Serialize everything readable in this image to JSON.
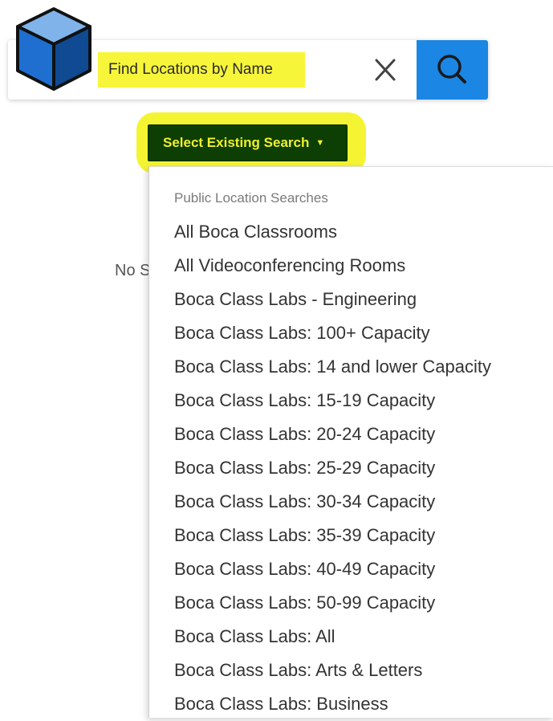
{
  "logo": {
    "icon": "cube-icon",
    "colors": {
      "top": "#7fb3ea",
      "left": "#1f6fd0",
      "right": "#0f4a93",
      "outline": "#111111"
    }
  },
  "search": {
    "placeholder": "Find Locations by Name",
    "value": "",
    "clear_icon": "close-icon",
    "submit_icon": "search-icon",
    "accent_color": "#1b86e3",
    "highlight_color": "#f7f53a"
  },
  "saved_search": {
    "button_label": "Select Existing Search",
    "caret_icon": "caret-down-icon",
    "button_color": "#0d3f04"
  },
  "background_text": "No S",
  "dropdown": {
    "header": "Public Location Searches",
    "items": [
      "All Boca Classrooms",
      "All Videoconferencing Rooms",
      "Boca Class Labs - Engineering",
      "Boca Class Labs: 100+ Capacity",
      "Boca Class Labs: 14 and lower Capacity",
      "Boca Class Labs: 15-19 Capacity",
      "Boca Class Labs: 20-24 Capacity",
      "Boca Class Labs: 25-29 Capacity",
      "Boca Class Labs: 30-34 Capacity",
      "Boca Class Labs: 35-39 Capacity",
      "Boca Class Labs: 40-49 Capacity",
      "Boca Class Labs: 50-99 Capacity",
      "Boca Class Labs: All",
      "Boca Class Labs: Arts & Letters",
      "Boca Class Labs: Business"
    ]
  }
}
